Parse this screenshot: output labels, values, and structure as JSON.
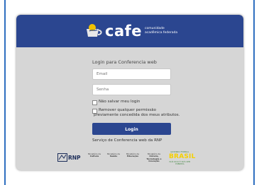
{
  "logo": {
    "name": "cafe",
    "sub_line1": "comunidade",
    "sub_line2": "acadêmica federada"
  },
  "login": {
    "title": "Login para Conferencia web",
    "email_placeholder": "Email",
    "password_placeholder": "Senha",
    "remember_label": "Não salvar meu login",
    "revoke_label_line1": "Remover qualquer permissão",
    "revoke_label_line2": "previamente concedida dos meus atributos.",
    "button_label": "Login",
    "service_text": "Serviço de Conferencia web da RNP"
  },
  "footer": {
    "rnp_label": "RNP",
    "ministries": [
      {
        "prefix": "Ministério da",
        "name": "Cultura"
      },
      {
        "prefix": "Ministério da",
        "name": "Saúde"
      },
      {
        "prefix": "Ministério da",
        "name": "Educação"
      },
      {
        "prefix": "Ministério da",
        "name": "Ciência, Tecnologia e Inovação"
      }
    ],
    "brasil_top": "GOVERNO FEDERAL",
    "brasil_text": "BRASIL",
    "brasil_bottom": "PAÍS RICO É PAÍS SEM POBREZA"
  },
  "colors": {
    "banner": "#2b4690",
    "card": "#d6d6d6",
    "button": "#2b4690",
    "page_border": "#2f6fc0"
  }
}
